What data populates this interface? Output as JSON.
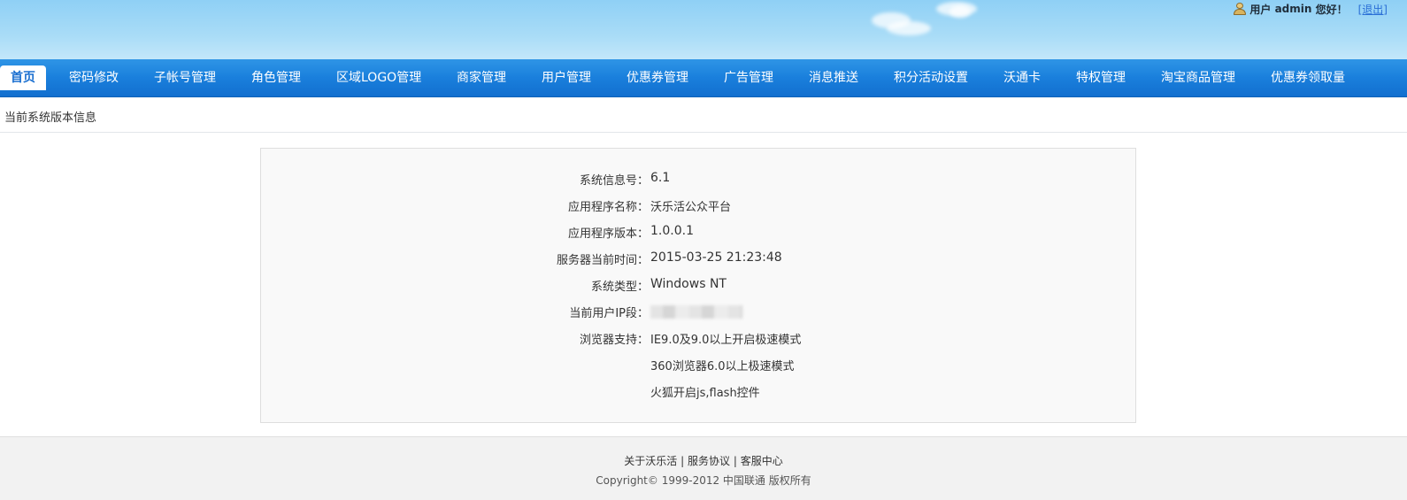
{
  "header": {
    "greeting_user": "用户",
    "username": "admin",
    "greeting": "您好！",
    "logout_label": "[退出]"
  },
  "nav": {
    "items": [
      {
        "label": "首页",
        "active": true
      },
      {
        "label": "密码修改"
      },
      {
        "label": "子帐号管理"
      },
      {
        "label": "角色管理"
      },
      {
        "label": "区域LOGO管理"
      },
      {
        "label": "商家管理"
      },
      {
        "label": "用户管理"
      },
      {
        "label": "优惠券管理"
      },
      {
        "label": "广告管理"
      },
      {
        "label": "消息推送"
      },
      {
        "label": "积分活动设置"
      },
      {
        "label": "沃通卡"
      },
      {
        "label": "特权管理"
      },
      {
        "label": "淘宝商品管理"
      },
      {
        "label": "优惠券领取量"
      }
    ]
  },
  "breadcrumb": "当前系统版本信息",
  "info": {
    "system_info_label": "系统信息号：",
    "system_info_value": "6.1",
    "app_name_label": "应用程序名称：",
    "app_name_value": "沃乐活公众平台",
    "app_version_label": "应用程序版本：",
    "app_version_value": "1.0.0.1",
    "server_time_label": "服务器当前时间：",
    "server_time_value": "2015-03-25 21:23:48",
    "os_label": "系统类型：",
    "os_value": "Windows NT",
    "ip_label": "当前用户IP段：",
    "browser_label": "浏览器支持：",
    "browser_1": "IE9.0及9.0以上开启极速模式",
    "browser_2": "360浏览器6.0以上极速模式",
    "browser_3": "火狐开启js,flash控件"
  },
  "footer": {
    "about": "关于沃乐活",
    "separator": "|",
    "agreement": "服务协议",
    "service": "客服中心",
    "copyright": "Copyright© 1999-2012 中国联通 版权所有"
  },
  "colors": {
    "nav_bg": "#1a7fdc",
    "header_sky": "#a9dcf7",
    "link": "#2a6fd6"
  }
}
